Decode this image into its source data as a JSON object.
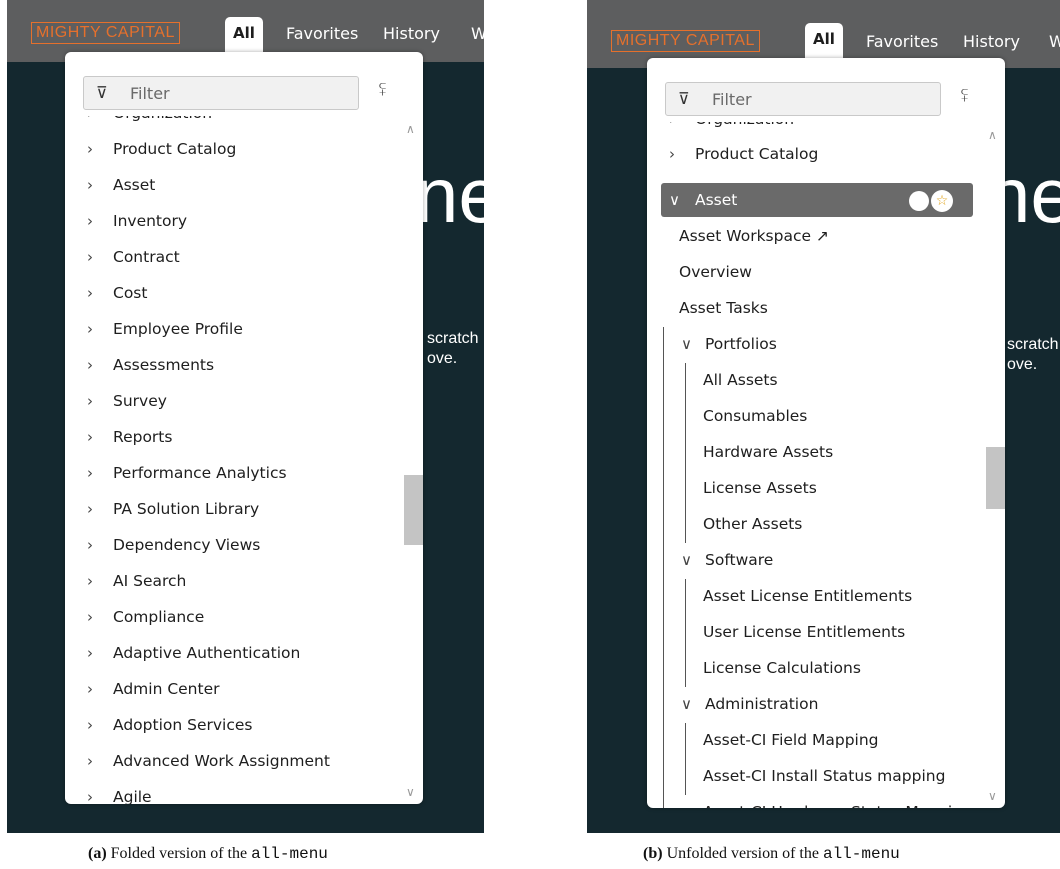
{
  "panel_a": {
    "header": {
      "logo": "MIGHTY CAPITAL",
      "tabs": [
        "All",
        "Favorites",
        "History",
        "W"
      ]
    },
    "background_text": {
      "big": "ne",
      "line1": "scratch",
      "line2": "ove."
    },
    "filter": {
      "placeholder": "Filter",
      "filter_icon": "⊽",
      "pin_icon": "⪿"
    },
    "partial_top": "Organization",
    "items": [
      "Product Catalog",
      "Asset",
      "Inventory",
      "Contract",
      "Cost",
      "Employee Profile",
      "Assessments",
      "Survey",
      "Reports",
      "Performance Analytics",
      "PA Solution Library",
      "Dependency Views",
      "AI Search",
      "Compliance",
      "Adaptive Authentication",
      "Admin Center",
      "Adoption Services",
      "Advanced Work Assignment"
    ],
    "partial_bottom": "Agile",
    "caption": {
      "tag": "(a)",
      "text": "Folded version of the",
      "code": "all-menu"
    }
  },
  "panel_b": {
    "header": {
      "logo": "MIGHTY CAPITAL",
      "tabs": [
        "All",
        "Favorites",
        "History",
        "W"
      ]
    },
    "background_text": {
      "big": "ne",
      "line1": "scratch",
      "line2": "ove."
    },
    "filter": {
      "placeholder": "Filter",
      "filter_icon": "⊽",
      "pin_icon": "⪿"
    },
    "partial_top": "Organization",
    "product_catalog": "Product Catalog",
    "selected": {
      "label": "Asset",
      "star_icon": "☆"
    },
    "asset_links": [
      "Asset Workspace ↗",
      "Overview",
      "Asset Tasks"
    ],
    "groups": [
      {
        "label": "Portfolios",
        "children": [
          "All Assets",
          "Consumables",
          "Hardware Assets",
          "License Assets",
          "Other Assets"
        ]
      },
      {
        "label": "Software",
        "children": [
          "Asset License Entitlements",
          "User License Entitlements",
          "License Calculations"
        ]
      },
      {
        "label": "Administration",
        "children": [
          "Asset-CI Field Mapping",
          "Asset-CI Install Status mapping"
        ]
      }
    ],
    "partial_bottom": "Asset-CI Hardware Status Mapping",
    "caption": {
      "tag": "(b)",
      "text": "Unfolded version of the",
      "code": "all-menu"
    }
  },
  "icons": {
    "chevron_right": "›",
    "chevron_down": "∨",
    "scroll_up": "∧",
    "scroll_down": "∨"
  },
  "colors": {
    "header_bg": "#5d5e5f",
    "page_bg": "#14282f",
    "logo": "#e5702c",
    "selected_bg": "#6a6a6a",
    "star": "#e0a31a"
  }
}
